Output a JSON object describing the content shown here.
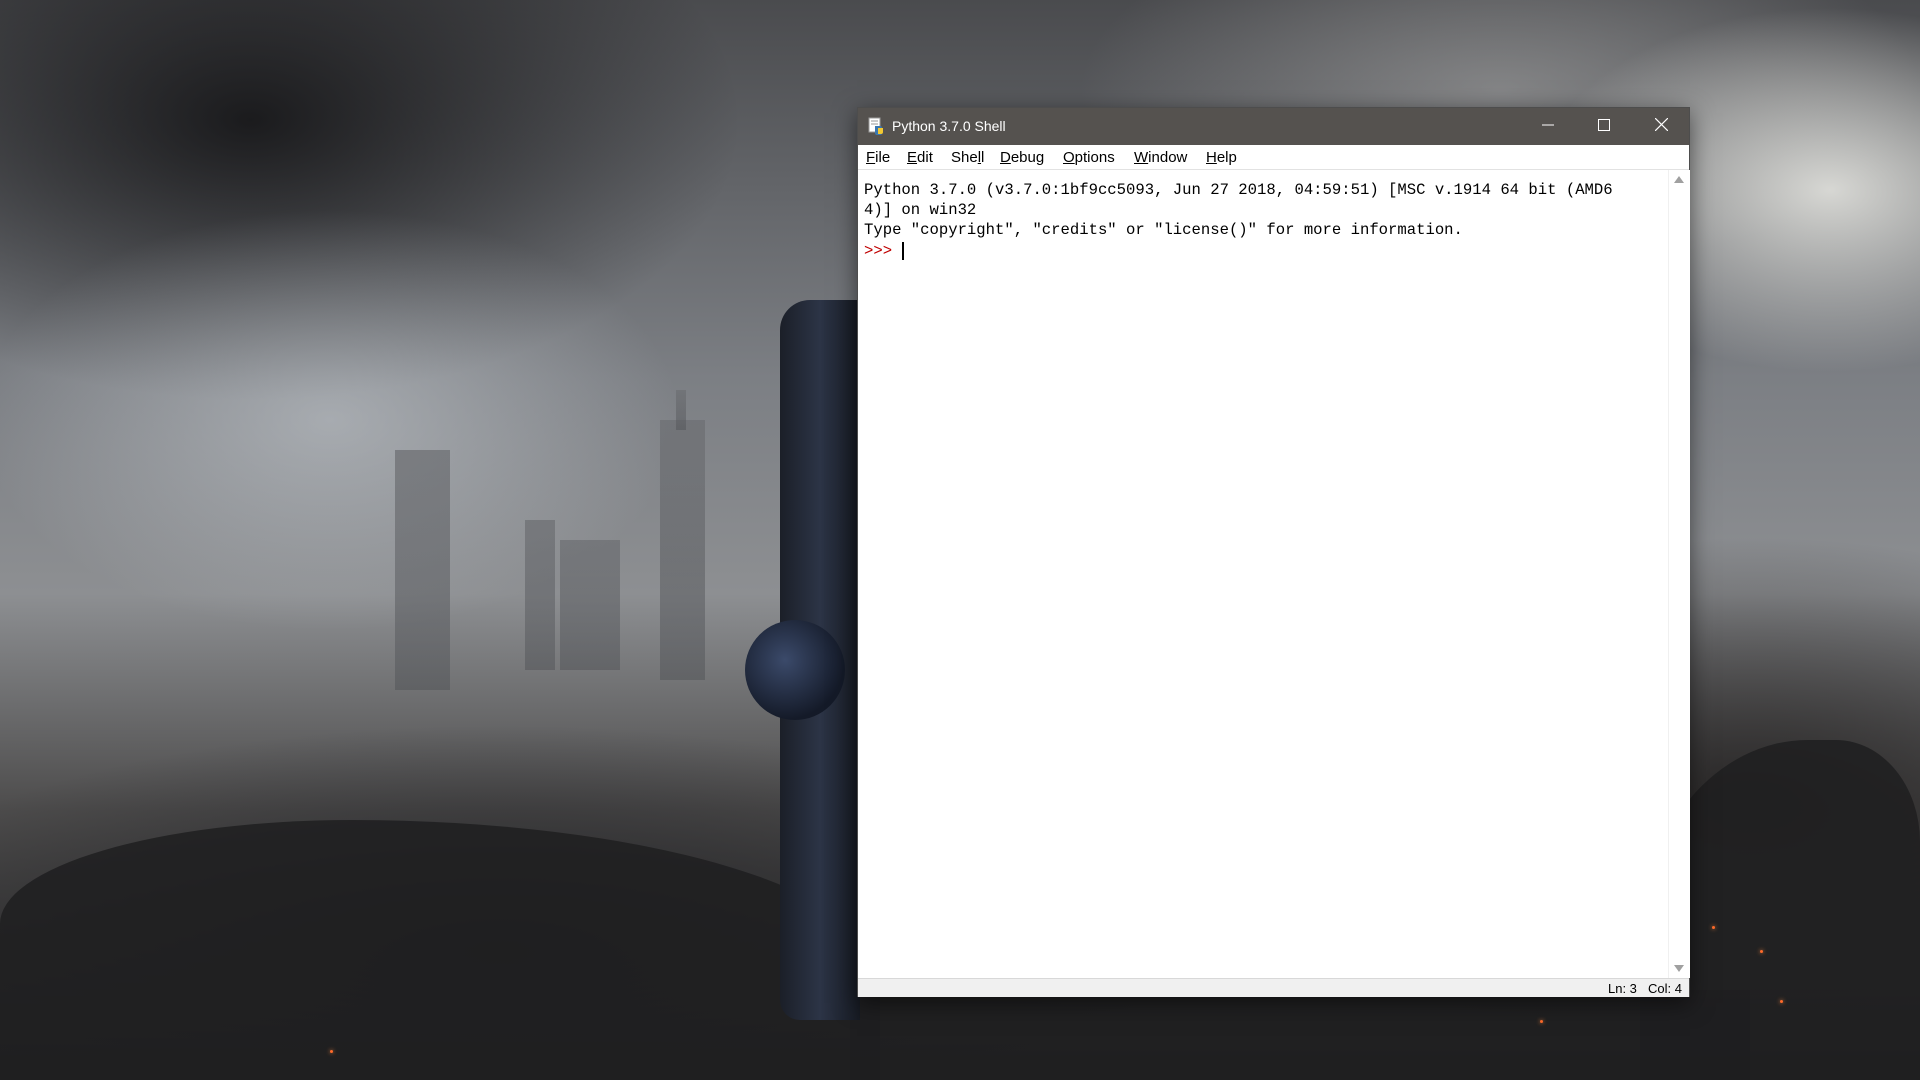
{
  "window": {
    "title": "Python 3.7.0 Shell",
    "controls": {
      "minimize": "minimize-icon",
      "maximize": "maximize-icon",
      "close": "close-icon"
    }
  },
  "menu": [
    {
      "label": "File",
      "underline": "F",
      "rest": "ile"
    },
    {
      "label": "Edit",
      "underline": "E",
      "rest": "dit"
    },
    {
      "label": "Shell",
      "pre": "She",
      "underline": "l",
      "rest": "l"
    },
    {
      "label": "Debug",
      "underline": "D",
      "rest": "ebug"
    },
    {
      "label": "Options",
      "underline": "O",
      "rest": "ptions"
    },
    {
      "label": "Window",
      "underline": "W",
      "rest": "indow"
    },
    {
      "label": "Help",
      "underline": "H",
      "rest": "elp"
    }
  ],
  "shell": {
    "lines": [
      "Python 3.7.0 (v3.7.0:1bf9cc5093, Jun 27 2018, 04:59:51) [MSC v.1914 64 bit (AMD6",
      "4)] on win32",
      "Type \"copyright\", \"credits\" or \"license()\" for more information."
    ],
    "prompt": ">>> "
  },
  "status": {
    "line": "Ln: 3",
    "col": "Col: 4"
  },
  "colors": {
    "titlebar": "#55524f",
    "prompt": "#c00000"
  }
}
